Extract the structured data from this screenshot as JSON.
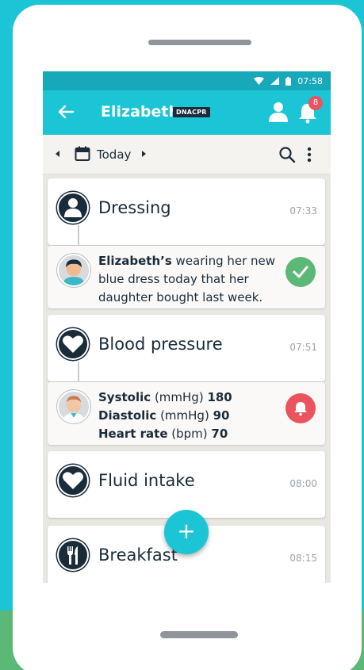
{
  "statusbar": {
    "time": "07:58",
    "icons": [
      "wifi-icon",
      "signal-icon",
      "battery-icon"
    ]
  },
  "appbar": {
    "back_icon": "arrow-left-icon",
    "title": "Elizabeth",
    "badge": "DNACPR",
    "profile_icon": "person-icon",
    "notifications_icon": "bell-icon",
    "notification_count": "8"
  },
  "datebar": {
    "prev_icon": "caret-left-icon",
    "calendar_icon": "calendar-icon",
    "date_label": "Today",
    "next_icon": "caret-right-icon",
    "search_icon": "search-icon",
    "more_icon": "more-vertical-icon"
  },
  "entries": [
    {
      "title": "Dressing",
      "time": "07:33",
      "icon": "person-icon",
      "note": {
        "name": "Elizabeth’s",
        "text": " wearing her new blue dress today that her daughter bought last week.",
        "status_icon": "check-icon"
      }
    },
    {
      "title": "Blood pressure",
      "time": "07:51",
      "icon": "heart-icon",
      "readings": [
        {
          "label": "Systolic",
          "unit": " (mmHg) ",
          "value": "180"
        },
        {
          "label": "Diastolic",
          "unit": " (mmHg) ",
          "value": "90"
        },
        {
          "label": "Heart rate",
          "unit": " (bpm) ",
          "value": "70"
        }
      ],
      "status_icon": "bell-icon"
    },
    {
      "title": "Fluid intake",
      "time": "08:00",
      "icon": "heart-icon"
    },
    {
      "title": "Breakfast",
      "time": "08:15",
      "icon": "cutlery-icon"
    }
  ],
  "fab": {
    "label": "+"
  },
  "colors": {
    "accent": "#1cc5d6",
    "dark": "#1a2b3a",
    "success": "#5cb876",
    "alert": "#e9545e"
  }
}
